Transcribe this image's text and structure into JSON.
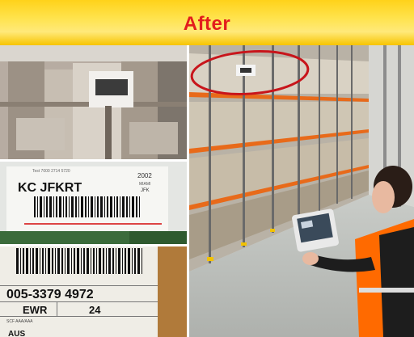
{
  "banner": {
    "title": "After"
  },
  "label_small": {
    "header": "Test 7000 2714 5720",
    "code": "KC JFKRT",
    "side_top": "2002",
    "side_mid": "MIAMI",
    "side_bot": "JFK"
  },
  "label_large": {
    "awb": "005-3379 4972",
    "dest": "EWR",
    "pieces": "24",
    "line": "SCF AAA/AAA",
    "footer": "AUS"
  },
  "colors": {
    "banner_yellow": "#ffd21a",
    "title_red": "#e31d1d",
    "highlight_ring": "#c8151b",
    "vest_orange": "#ff6a00",
    "rack_orange": "#e86a1a"
  }
}
